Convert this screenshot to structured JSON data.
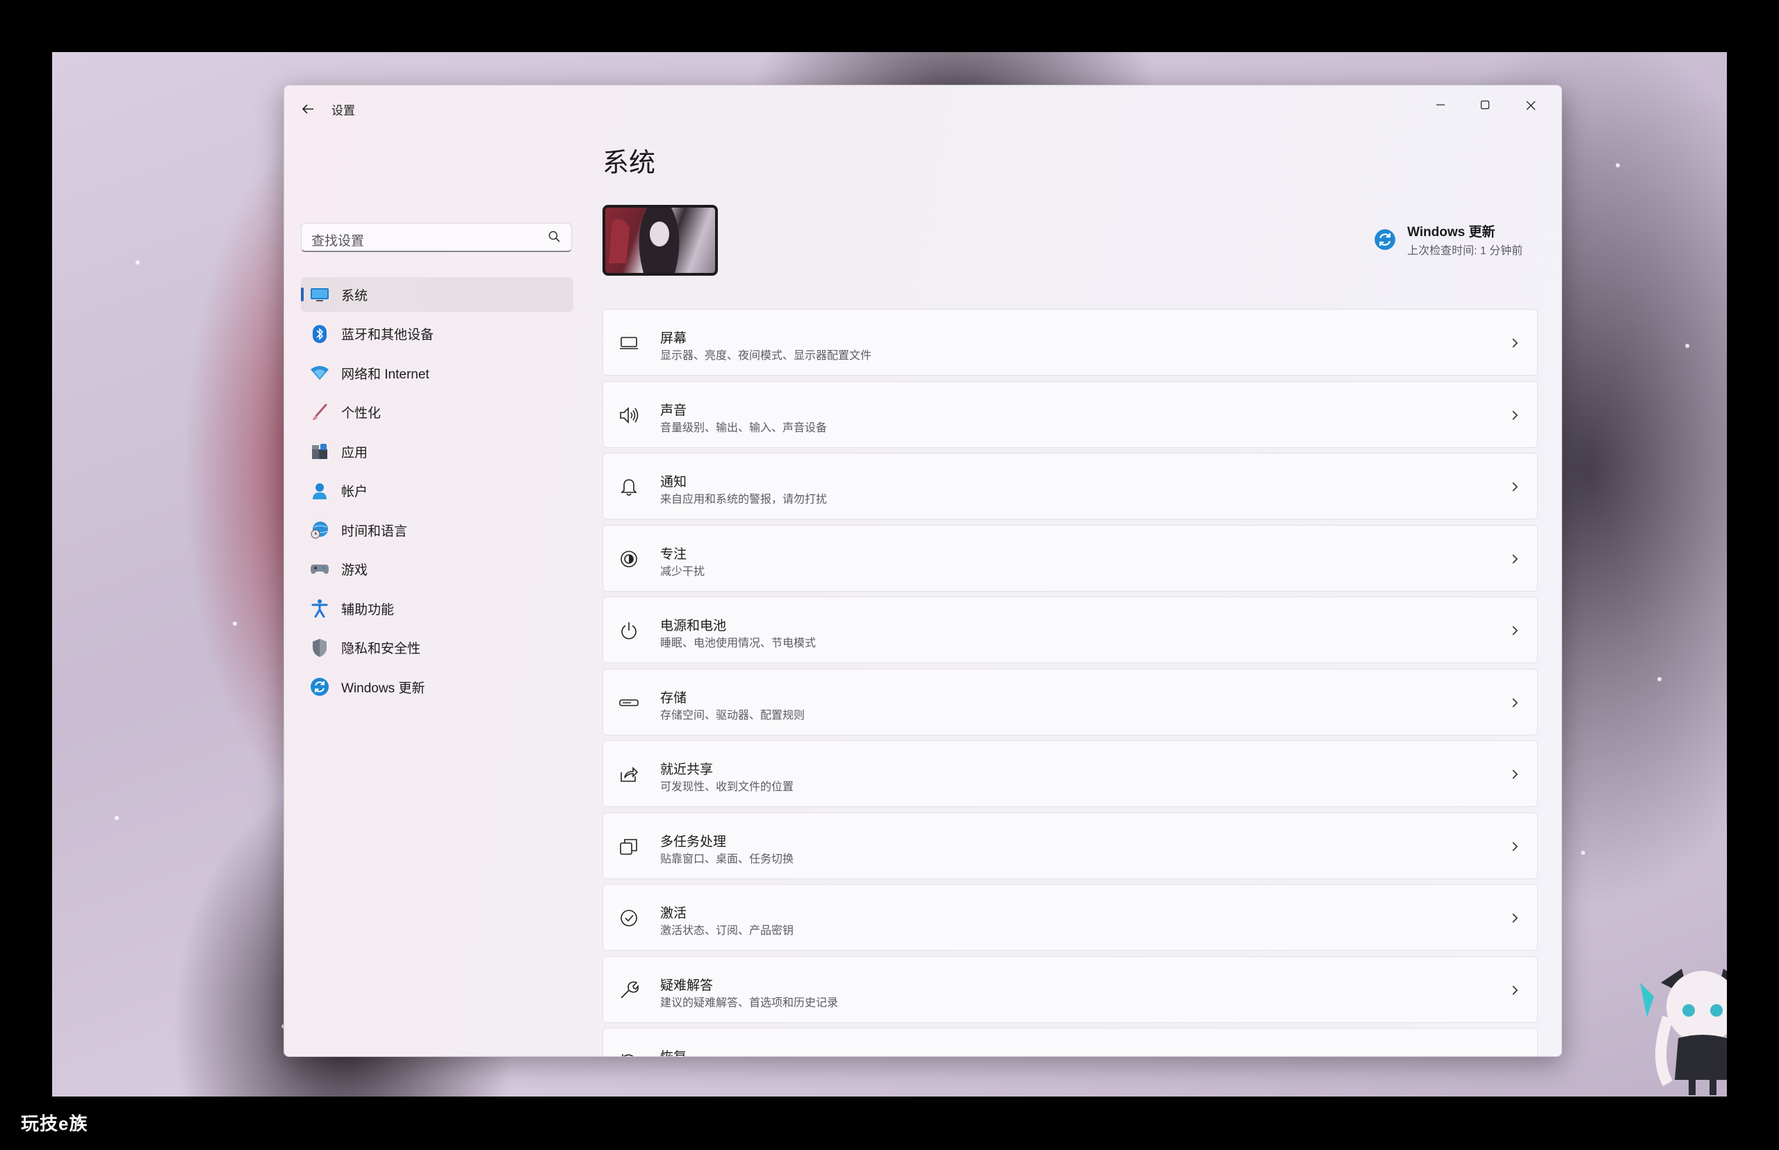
{
  "window": {
    "title": "设置",
    "controls": {
      "minimize": "—",
      "maximize": "☐",
      "close": "✕"
    }
  },
  "search": {
    "placeholder": "查找设置"
  },
  "sidebar": {
    "items": [
      {
        "label": "系统",
        "icon": "system-icon",
        "active": true
      },
      {
        "label": "蓝牙和其他设备",
        "icon": "bluetooth-icon"
      },
      {
        "label": "网络和 Internet",
        "icon": "wifi-icon"
      },
      {
        "label": "个性化",
        "icon": "brush-icon"
      },
      {
        "label": "应用",
        "icon": "apps-icon"
      },
      {
        "label": "帐户",
        "icon": "account-icon"
      },
      {
        "label": "时间和语言",
        "icon": "globe-clock-icon"
      },
      {
        "label": "游戏",
        "icon": "gamepad-icon"
      },
      {
        "label": "辅助功能",
        "icon": "accessibility-icon"
      },
      {
        "label": "隐私和安全性",
        "icon": "shield-icon"
      },
      {
        "label": "Windows 更新",
        "icon": "update-icon"
      }
    ]
  },
  "main": {
    "title": "系统",
    "windows_update": {
      "title": "Windows 更新",
      "subtitle": "上次检查时间: 1 分钟前"
    },
    "cards": [
      {
        "title": "屏幕",
        "subtitle": "显示器、亮度、夜间模式、显示器配置文件",
        "icon": "display-icon"
      },
      {
        "title": "声音",
        "subtitle": "音量级别、输出、输入、声音设备",
        "icon": "speaker-icon"
      },
      {
        "title": "通知",
        "subtitle": "来自应用和系统的警报，请勿打扰",
        "icon": "bell-icon"
      },
      {
        "title": "专注",
        "subtitle": "减少干扰",
        "icon": "focus-icon"
      },
      {
        "title": "电源和电池",
        "subtitle": "睡眠、电池使用情况、节电模式",
        "icon": "power-icon"
      },
      {
        "title": "存储",
        "subtitle": "存储空间、驱动器、配置规则",
        "icon": "storage-icon"
      },
      {
        "title": "就近共享",
        "subtitle": "可发现性、收到文件的位置",
        "icon": "share-icon"
      },
      {
        "title": "多任务处理",
        "subtitle": "贴靠窗口、桌面、任务切换",
        "icon": "multitask-icon"
      },
      {
        "title": "激活",
        "subtitle": "激活状态、订阅、产品密钥",
        "icon": "check-circle-icon"
      },
      {
        "title": "疑难解答",
        "subtitle": "建议的疑难解答、首选项和历史记录",
        "icon": "wrench-icon"
      },
      {
        "title": "恢复",
        "subtitle": "",
        "icon": "recovery-icon"
      }
    ]
  },
  "watermark": "玩技e族",
  "colors": {
    "accent": "#2b63b8",
    "update_blue": "#1e88d4"
  }
}
